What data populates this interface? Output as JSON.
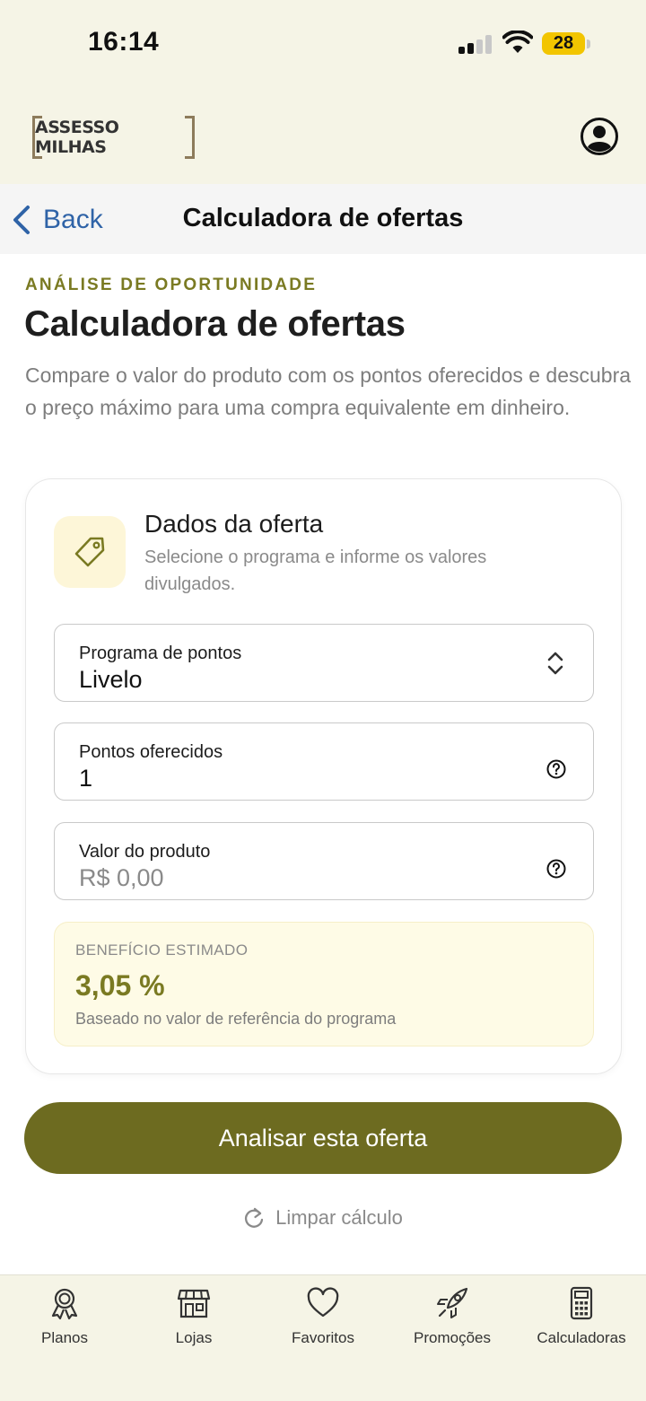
{
  "status": {
    "time": "16:14",
    "battery": "28"
  },
  "header": {
    "logo": "ASSESSO MILHAS"
  },
  "nav": {
    "back_label": "Back",
    "title": "Calculadora de ofertas"
  },
  "main": {
    "eyebrow": "ANÁLISE DE OPORTUNIDADE",
    "title": "Calculadora de ofertas",
    "description": "Compare o valor do produto com os pontos oferecidos e descubra o preço máximo para uma compra equivalente em dinheiro."
  },
  "card": {
    "icon": "tag-icon",
    "title": "Dados da oferta",
    "subtitle": "Selecione o programa e informe os valores divulgados.",
    "fields": [
      {
        "label": "Programa de pontos",
        "value": "Livelo",
        "icon": "chevron-up-down-icon"
      },
      {
        "label": "Pontos oferecidos",
        "value": "1",
        "icon": "help-circle-icon"
      },
      {
        "label": "Valor do produto",
        "placeholder": "R$ 0,00",
        "icon": "help-circle-icon"
      }
    ],
    "benefit": {
      "label": "BENEFÍCIO ESTIMADO",
      "value": "3,05 %",
      "note": "Baseado no valor de referência do programa"
    }
  },
  "actions": {
    "primary": "Analisar esta oferta",
    "reset": "Limpar cálculo"
  },
  "tabs": [
    {
      "label": "Planos",
      "icon": "award-ribbon-icon"
    },
    {
      "label": "Lojas",
      "icon": "store-icon"
    },
    {
      "label": "Favoritos",
      "icon": "heart-icon"
    },
    {
      "label": "Promoções",
      "icon": "rocket-icon"
    },
    {
      "label": "Calculadoras",
      "icon": "calculator-icon"
    }
  ],
  "colors": {
    "accent": "#6d6b20",
    "eyebrow": "#7a7a22",
    "link": "#2f63a7",
    "background": "#f5f4e6",
    "battery": "#f2c500"
  }
}
